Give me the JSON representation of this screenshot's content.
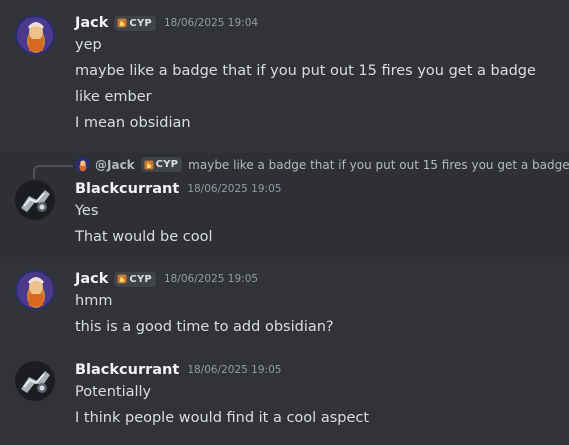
{
  "messages": [
    {
      "username": "Jack",
      "tag": "CYP",
      "timestamp": "18/06/2025 19:04",
      "lines": [
        "yep",
        "maybe like a badge that if you put out 15 fires you get a badge",
        "like ember",
        "I mean obsidian"
      ]
    },
    {
      "reply": {
        "user": "@Jack",
        "tag": "CYP",
        "text": "maybe like a badge that if you put out 15 fires you get a badge"
      },
      "username": "Blackcurrant",
      "timestamp": "18/06/2025 19:05",
      "lines": [
        "Yes",
        "That would be cool"
      ]
    },
    {
      "username": "Jack",
      "tag": "CYP",
      "timestamp": "18/06/2025 19:05",
      "lines": [
        "hmm",
        "this is a good time to add obsidian?"
      ]
    },
    {
      "username": "Blackcurrant",
      "timestamp": "18/06/2025 19:05",
      "lines": [
        "Potentially",
        "I think people would find it a cool aspect"
      ]
    }
  ],
  "colors": {
    "background": "#313338",
    "highlight": "#2e3035",
    "username": "#f2f3f5",
    "text": "#dbdee1",
    "timestamp": "#949ba4",
    "tag_bg": "#41434a",
    "tag_icon": "#f0b232"
  },
  "icons": {
    "tag_icon": "flame-icon",
    "jack_avatar": "jack-avatar",
    "blackcurrant_avatar": "blackcurrant-avatar"
  }
}
